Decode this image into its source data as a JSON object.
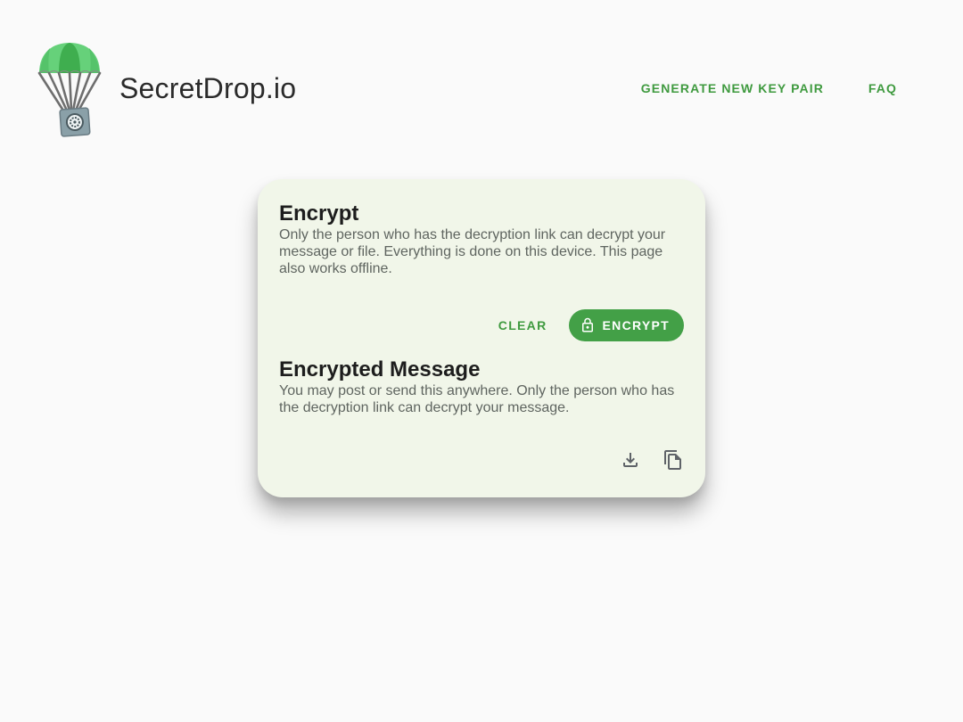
{
  "header": {
    "site_title": "SecretDrop.io",
    "nav": [
      {
        "label": "GENERATE NEW KEY PAIR"
      },
      {
        "label": "FAQ"
      }
    ]
  },
  "encrypt_section": {
    "title": "Encrypt",
    "description": "Only the person who has the decryption link can decrypt your message or file. Everything is done on this device. This page also works offline.",
    "clear_label": "CLEAR",
    "encrypt_label": "ENCRYPT"
  },
  "encrypted_section": {
    "title": "Encrypted Message",
    "description": "You may post or send this anywhere. Only the person who has the decryption link can decrypt your message.",
    "icons": [
      "download-icon",
      "copy-icon"
    ]
  },
  "colors": {
    "accent": "#3f9a3f",
    "button_bg": "#43a047",
    "card_bg": "#f1f6e9",
    "page_bg": "#fafafa",
    "parachute_light": "#66d17a",
    "parachute_dark": "#3fae4f"
  }
}
